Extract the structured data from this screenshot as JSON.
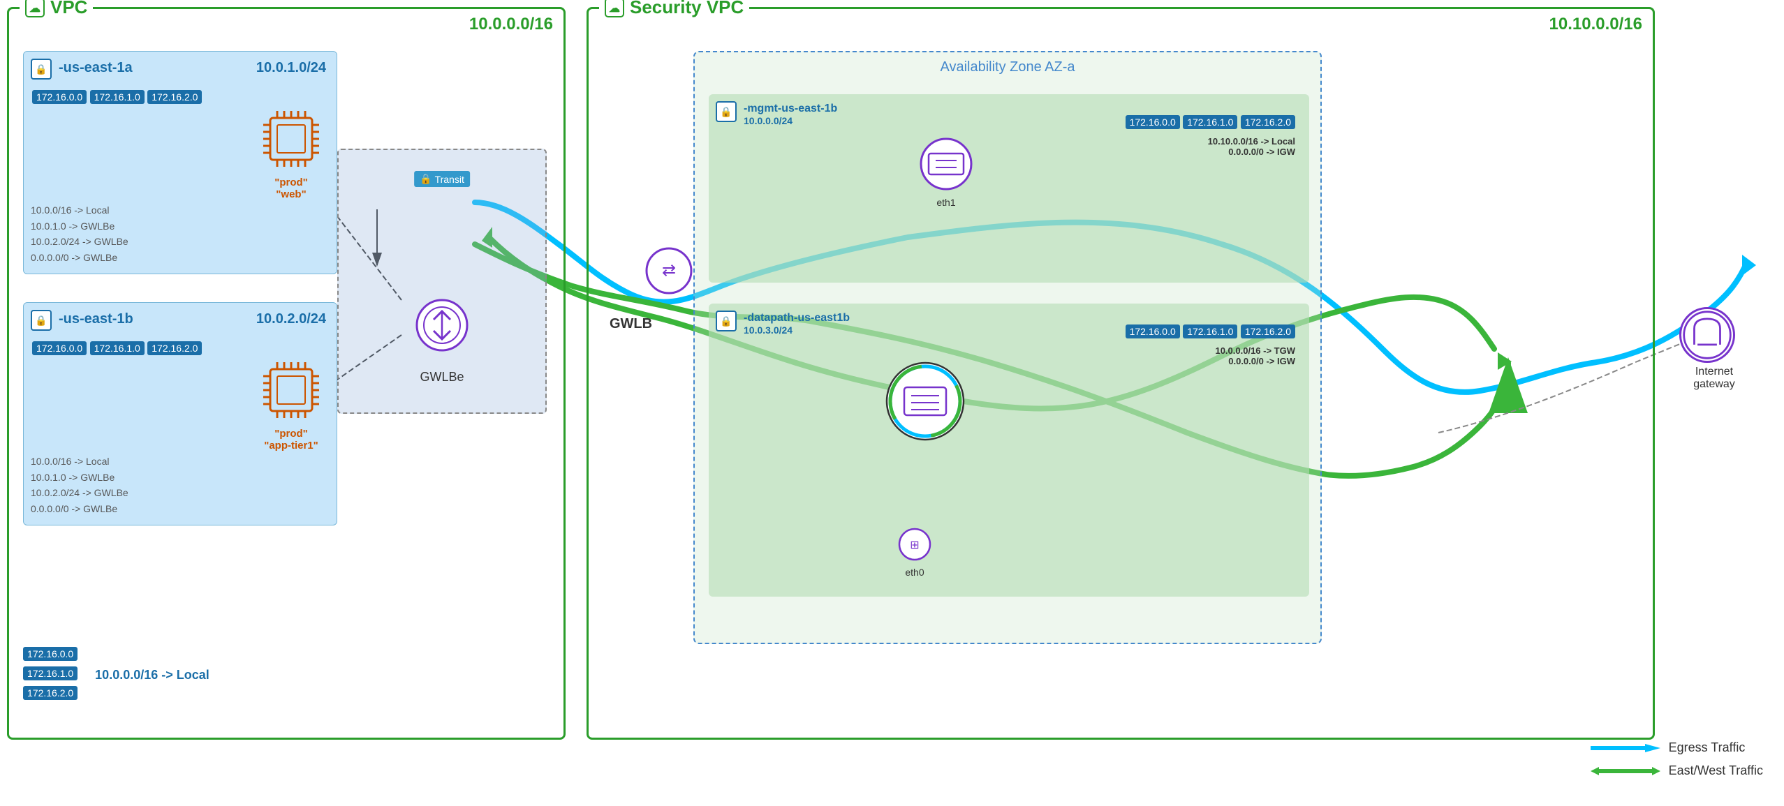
{
  "vpc": {
    "title": "VPC",
    "cidr": "10.0.0.0/16",
    "az1a": {
      "label": "-us-east-1a",
      "cidr": "10.0.1.0/24",
      "tags": [
        "172.16.0.0",
        "172.16.1.0",
        "172.16.2.0"
      ],
      "routes": "10.0.0/16 -> Local\n10.0.1.0 -> GWLBe\n10.0.2.0/24 -> GWLBe\n0.0.0.0/0 -> GWLBe",
      "instance": "\"prod\"\n\"web\""
    },
    "az1b": {
      "label": "-us-east-1b",
      "cidr": "10.0.2.0/24",
      "tags": [
        "172.16.0.0",
        "172.16.1.0",
        "172.16.2.0"
      ],
      "routes": "10.0.0/16 -> Local\n10.0.1.0 -> GWLBe\n10.0.2.0/24 -> GWLBe\n0.0.0.0/0 -> GWLBe",
      "instance": "\"prod\"\n\"app-tier1\""
    },
    "bottom_tags": [
      "172.16.0.0",
      "172.16.1.0",
      "172.16.2.0"
    ],
    "bottom_route": "10.0.0.0/16 -> Local"
  },
  "security_vpc": {
    "title": "Security VPC",
    "cidr": "10.10.0.0/16",
    "az_label": "Availability Zone AZ-a",
    "mgmt_subnet": {
      "label": "-mgmt-us-east-1b",
      "cidr": "10.0.0.0/24",
      "tags": [
        "172.16.0.0",
        "172.16.1.0",
        "172.16.2.0"
      ],
      "routes": "10.10.0.0/16 -> Local\n0.0.0.0/0 -> IGW",
      "eth": "eth1"
    },
    "datapath_subnet": {
      "label": "-datapath-us-east1b",
      "cidr": "10.0.3.0/24",
      "tags": [
        "172.16.0.0",
        "172.16.1.0",
        "172.16.2.0"
      ],
      "routes": "10.0.0.0/16 -> TGW\n0.0.0.0/0 -> IGW",
      "eth": "eth0"
    }
  },
  "labels": {
    "transit": "Transit",
    "gwlbe": "GWLBe",
    "gwlb": "GWLB",
    "internet_gateway": "Internet gateway"
  },
  "legend": {
    "egress": "Egress Traffic",
    "east_west": "East/West Traffic"
  }
}
